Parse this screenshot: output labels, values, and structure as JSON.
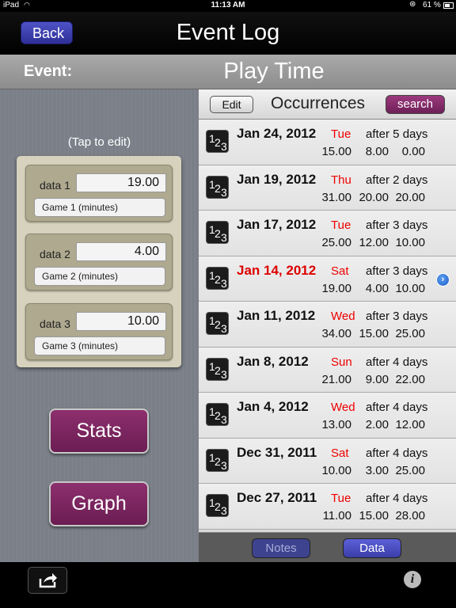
{
  "status": {
    "carrier": "iPad",
    "time": "11:13 AM",
    "battery": "61 %"
  },
  "nav": {
    "back_label": "Back",
    "title": "Event Log"
  },
  "event": {
    "label": "Event:",
    "name": "Play Time"
  },
  "editor": {
    "hint": "(Tap to edit)",
    "fields": [
      {
        "label": "data 1",
        "value": "19.00",
        "desc": "Game 1 (minutes)"
      },
      {
        "label": "data 2",
        "value": "4.00",
        "desc": "Game 2 (minutes)"
      },
      {
        "label": "data 3",
        "value": "10.00",
        "desc": "Game 3 (minutes)"
      }
    ],
    "stats_label": "Stats",
    "graph_label": "Graph"
  },
  "occurrences": {
    "edit_label": "Edit",
    "title": "Occurrences",
    "search_label": "search",
    "icon_digits": [
      "1",
      "2",
      "3"
    ],
    "rows": [
      {
        "date": "Jan 24, 2012",
        "dow": "Tue",
        "after": "after 5 days",
        "v1": "15.00",
        "v2": "8.00",
        "v3": "0.00"
      },
      {
        "date": "Jan 19, 2012",
        "dow": "Thu",
        "after": "after 2 days",
        "v1": "31.00",
        "v2": "20.00",
        "v3": "20.00"
      },
      {
        "date": "Jan 17, 2012",
        "dow": "Tue",
        "after": "after 3 days",
        "v1": "25.00",
        "v2": "12.00",
        "v3": "10.00"
      },
      {
        "date": "Jan 14, 2012",
        "dow": "Sat",
        "after": "after 3 days",
        "v1": "19.00",
        "v2": "4.00",
        "v3": "10.00"
      },
      {
        "date": "Jan 11, 2012",
        "dow": "Wed",
        "after": "after 3 days",
        "v1": "34.00",
        "v2": "15.00",
        "v3": "25.00"
      },
      {
        "date": "Jan 8, 2012",
        "dow": "Sun",
        "after": "after 4 days",
        "v1": "21.00",
        "v2": "9.00",
        "v3": "22.00"
      },
      {
        "date": "Jan 4, 2012",
        "dow": "Wed",
        "after": "after 4 days",
        "v1": "13.00",
        "v2": "2.00",
        "v3": "12.00"
      },
      {
        "date": "Dec 31, 2011",
        "dow": "Sat",
        "after": "after 4 days",
        "v1": "10.00",
        "v2": "3.00",
        "v3": "25.00"
      },
      {
        "date": "Dec 27, 2011",
        "dow": "Tue",
        "after": "after 4 days",
        "v1": "11.00",
        "v2": "15.00",
        "v3": "28.00"
      }
    ],
    "notes_label": "Notes",
    "data_label": "Data"
  },
  "colors": {
    "accent_purple": "#7a2461",
    "nav_blue": "#3a3ea8",
    "weekday_red": "#e00000"
  },
  "icons": {
    "wifi": "wifi-icon",
    "lock": "rotation-lock-icon",
    "share": "share-icon",
    "info": "info-icon",
    "disclosure": "disclosure-icon",
    "numbers": "numbers-icon"
  }
}
